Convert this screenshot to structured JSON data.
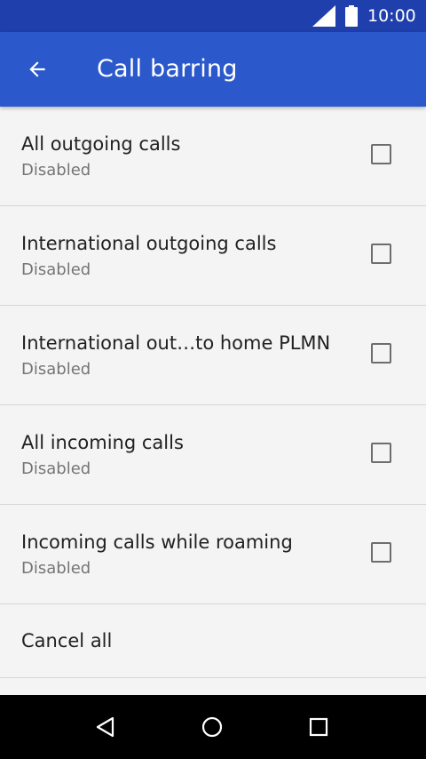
{
  "status_bar": {
    "time": "10:00",
    "icons": [
      "signal-icon",
      "battery-icon"
    ]
  },
  "app_bar": {
    "title": "Call barring",
    "back_icon": "arrow-back-icon"
  },
  "settings": [
    {
      "label": "All outgoing calls",
      "status": "Disabled",
      "checked": false
    },
    {
      "label": "International outgoing calls",
      "status": "Disabled",
      "checked": false
    },
    {
      "label": "International out…to home PLMN",
      "status": "Disabled",
      "checked": false
    },
    {
      "label": "All incoming calls",
      "status": "Disabled",
      "checked": false
    },
    {
      "label": "Incoming calls while roaming",
      "status": "Disabled",
      "checked": false
    }
  ],
  "actions": {
    "cancel_all": "Cancel all"
  },
  "nav_bar": {
    "buttons": [
      "back-triangle-icon",
      "home-circle-icon",
      "recents-square-icon"
    ]
  },
  "colors": {
    "status_bar": "#1f3fac",
    "app_bar": "#2b58ca",
    "background": "#f4f4f4"
  }
}
